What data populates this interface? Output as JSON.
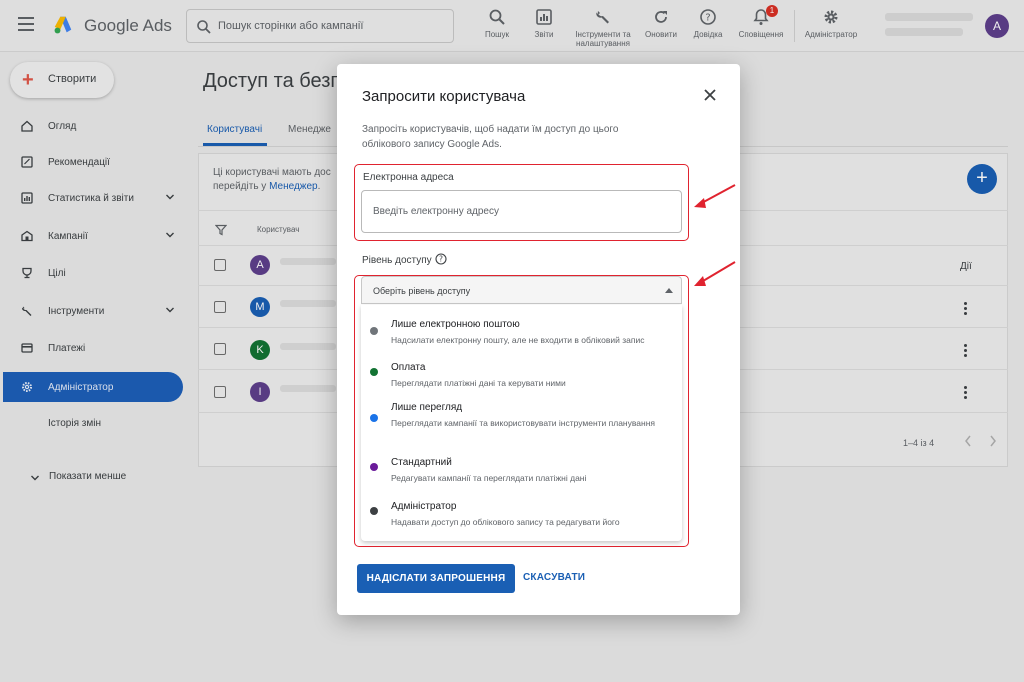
{
  "header": {
    "app_name": "Google Ads",
    "search_placeholder": "Пошук сторінки або кампанії",
    "tools": [
      {
        "label": "Пошук",
        "icon": "search-icon"
      },
      {
        "label": "Звіти",
        "icon": "reports-icon"
      },
      {
        "label": "Інструменти та налаштування",
        "icon": "wrench-icon"
      },
      {
        "label": "Оновити",
        "icon": "refresh-icon"
      },
      {
        "label": "Довідка",
        "icon": "help-icon"
      },
      {
        "label": "Сповіщення",
        "icon": "bell-icon",
        "badge": "1"
      },
      {
        "label": "Адміністратор",
        "icon": "gear-icon"
      }
    ],
    "avatar_letter": "A"
  },
  "sidebar": {
    "create_label": "Створити",
    "items": [
      {
        "label": "Огляд",
        "icon": "home-icon"
      },
      {
        "label": "Рекомендації",
        "icon": "recommendations-icon"
      },
      {
        "label": "Статистика й звіти",
        "icon": "chart-icon"
      },
      {
        "label": "Кампанії",
        "icon": "campaigns-icon"
      },
      {
        "label": "Цілі",
        "icon": "goals-icon"
      },
      {
        "label": "Інструменти",
        "icon": "tools-icon"
      },
      {
        "label": "Платежі",
        "icon": "card-icon"
      },
      {
        "label": "Адміністратор",
        "icon": "gear-icon"
      },
      {
        "label": "Історія змін",
        "icon": ""
      }
    ],
    "show_less": "Показати менше"
  },
  "main": {
    "title": "Доступ та безпе",
    "tabs": [
      "Користувачі",
      "Менедже"
    ],
    "info_line1": "Ці користувачі мають дос",
    "info_line2_prefix": "перейдіть у ",
    "info_link": "Менеджер",
    "info_line2_suffix": ".",
    "column_header": "Користувач",
    "actions_header": "Дії",
    "users": [
      {
        "letter": "A",
        "color": "#5e3f8c"
      },
      {
        "letter": "M",
        "color": "#1a5fb4"
      },
      {
        "letter": "K",
        "color": "#137333"
      },
      {
        "letter": "I",
        "color": "#5e3f8c"
      }
    ],
    "pagination": "1–4 із 4"
  },
  "dialog": {
    "title": "Запросити користувача",
    "description": "Запросіть користувачів, щоб надати їм доступ до цього облікового запису Google Ads.",
    "email_label": "Електронна адреса",
    "email_placeholder": "Введіть електронну адресу",
    "email_value": "",
    "access_label": "Рівень доступу",
    "select_placeholder": "Оберіть рівень доступу",
    "options": [
      {
        "title": "Лише електронною поштою",
        "desc": "Надсилати електронну пошту, але не входити в обліковий запис",
        "color": "#70757a"
      },
      {
        "title": "Оплата",
        "desc": "Переглядати платіжні дані та керувати ними",
        "color": "#137333"
      },
      {
        "title": "Лише перегляд",
        "desc": "Переглядати кампанії та використовувати інструменти планування",
        "color": "#1a73e8"
      },
      {
        "title": "Стандартний",
        "desc": "Редагувати кампанії та переглядати платіжні дані",
        "color": "#6a1b9a"
      },
      {
        "title": "Адміністратор",
        "desc": "Надавати доступ до облікового запису та редагувати його",
        "color": "#3c4043"
      }
    ],
    "primary_button": "НАДІСЛАТИ ЗАПРОШЕННЯ",
    "cancel_button": "СКАСУВАТИ"
  },
  "colors": {
    "accent": "#1a5fb4",
    "highlight": "#e0232f"
  }
}
